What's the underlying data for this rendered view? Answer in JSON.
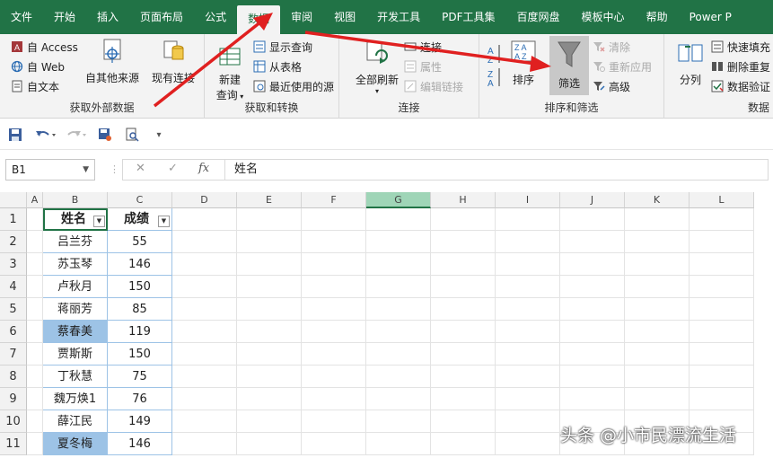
{
  "tabs": [
    "文件",
    "开始",
    "插入",
    "页面布局",
    "公式",
    "数据",
    "审阅",
    "视图",
    "开发工具",
    "PDF工具集",
    "百度网盘",
    "模板中心",
    "帮助",
    "Power P"
  ],
  "active_tab": "数据",
  "groups": {
    "external": {
      "label": "获取外部数据",
      "access": "自 Access",
      "web": "自 Web",
      "text": "自文本",
      "other": "自其他来源",
      "existing": "现有连接"
    },
    "transform": {
      "label": "获取和转换",
      "new_query": "新建",
      "new_query2": "查询",
      "show_query": "显示查询",
      "from_table": "从表格",
      "recent": "最近使用的源"
    },
    "connections": {
      "label": "连接",
      "refresh_all": "全部刷新",
      "connections": "连接",
      "properties": "属性",
      "edit_links": "编辑链接"
    },
    "sort_filter": {
      "label": "排序和筛选",
      "sort": "排序",
      "filter": "筛选",
      "clear": "清除",
      "reapply": "重新应用",
      "advanced": "高级"
    },
    "data_tools": {
      "label": "数据",
      "split": "分列",
      "flash_fill": "快速填充",
      "remove_dup": "删除重复",
      "validation": "数据验证"
    }
  },
  "formula_bar": {
    "name_box": "B1",
    "cancel": "✕",
    "enter": "✓",
    "fx": "fx",
    "content": "姓名"
  },
  "columns": [
    "A",
    "B",
    "C",
    "D",
    "E",
    "F",
    "G",
    "H",
    "I",
    "J",
    "K",
    "L"
  ],
  "selected_column": "G",
  "rows": [
    {
      "n": "1",
      "name": "姓名",
      "score": "成绩",
      "header": true
    },
    {
      "n": "2",
      "name": "吕兰芬",
      "score": "55"
    },
    {
      "n": "3",
      "name": "苏玉琴",
      "score": "146"
    },
    {
      "n": "4",
      "name": "卢秋月",
      "score": "150"
    },
    {
      "n": "5",
      "name": "蒋丽芳",
      "score": "85"
    },
    {
      "n": "6",
      "name": "蔡春美",
      "score": "119",
      "highlight": true
    },
    {
      "n": "7",
      "name": "贾斯斯",
      "score": "150"
    },
    {
      "n": "8",
      "name": "丁秋慧",
      "score": "75"
    },
    {
      "n": "9",
      "name": "魏万焕1",
      "score": "76"
    },
    {
      "n": "10",
      "name": "薛江民",
      "score": "149"
    },
    {
      "n": "11",
      "name": "夏冬梅",
      "score": "146",
      "highlight": true
    }
  ],
  "watermark": "头条 @小市民漂流生活",
  "colors": {
    "excel_green": "#217346",
    "highlight_blue": "#9dc3e6",
    "selected_col": "#9fd5b7",
    "arrow_red": "#e02020"
  }
}
